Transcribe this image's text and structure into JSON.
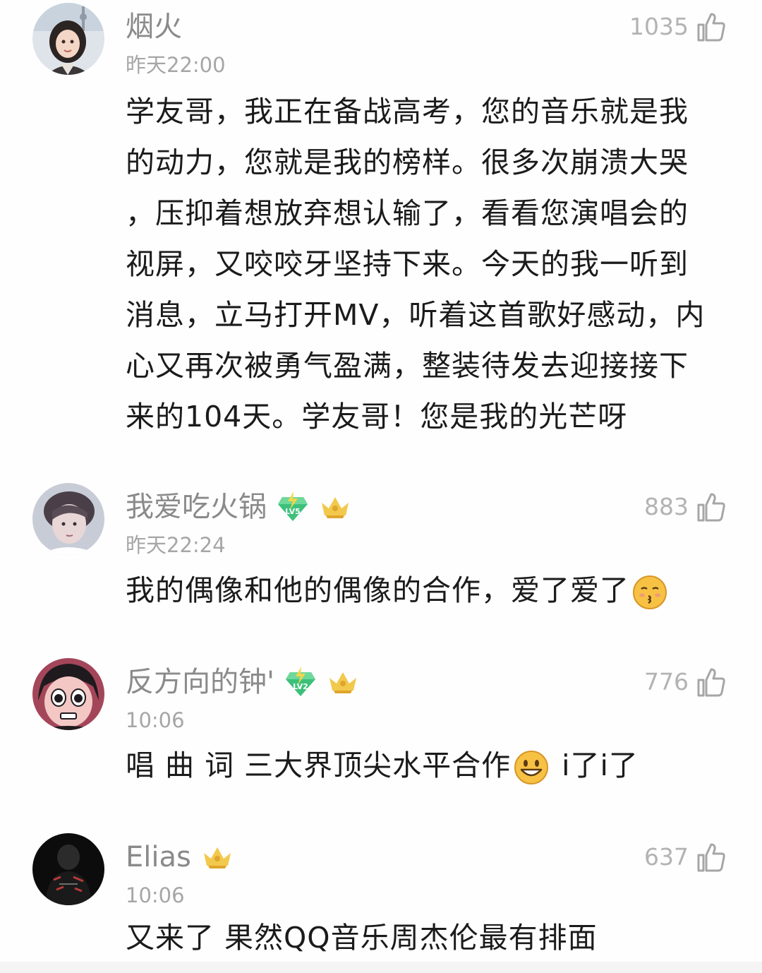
{
  "comments": [
    {
      "username": "烟火",
      "time": "昨天22:00",
      "likes": "1035",
      "text": "学友哥，我正在备战高考，您的音乐就是我的动力，您就是我的榜样。很多次崩溃大哭，压抑着想放弃想认输了，看看您演唱会的视屏，又咬咬牙坚持下来。今天的我一听到消息，立马打开MV，听着这首歌好感动，内心又再次被勇气盈满，整装待发去迎接接下来的104天。学友哥！您是我的光芒呀",
      "lines": [
        "学友哥，我正在备战高考，您的音乐就是我",
        "的动力，您就是我的榜样。很多次崩溃大哭",
        "，压抑着想放弃想认输了，看看您演唱会的",
        "视屏，又咬咬牙坚持下来。今天的我一听到",
        "消息，立马打开MV，听着这首歌好感动，内",
        "心又再次被勇气盈满，整装待发去迎接接下",
        "来的104天。学友哥！您是我的光芒呀"
      ]
    },
    {
      "username": "我爱吃火锅",
      "time": "昨天22:24",
      "likes": "883",
      "badges": [
        "level-badge-lv5",
        "crown-badge"
      ],
      "text": "我的偶像和他的偶像的合作，爱了爱了",
      "emoji": "kissing-face-emoji"
    },
    {
      "username": "反方向的钟'",
      "time": "10:06",
      "likes": "776",
      "badges": [
        "level-badge-lv2",
        "crown-badge"
      ],
      "text_a": "唱 曲 词 三大界顶尖水平合作",
      "emoji": "smiling-face-emoji",
      "text_b": "i了i了"
    },
    {
      "username": "Elias",
      "time": "10:06",
      "likes": "637",
      "badges": [
        "crown-badge"
      ],
      "text": "又来了 果然QQ音乐周杰伦最有排面"
    }
  ],
  "colors": {
    "username": "#8a8a8a",
    "time": "#a6a6a6",
    "likes": "#b3b3b3",
    "body": "#1b1b1b",
    "badge_green": "#3cc07a",
    "crown_gold": "#f2c94c"
  }
}
